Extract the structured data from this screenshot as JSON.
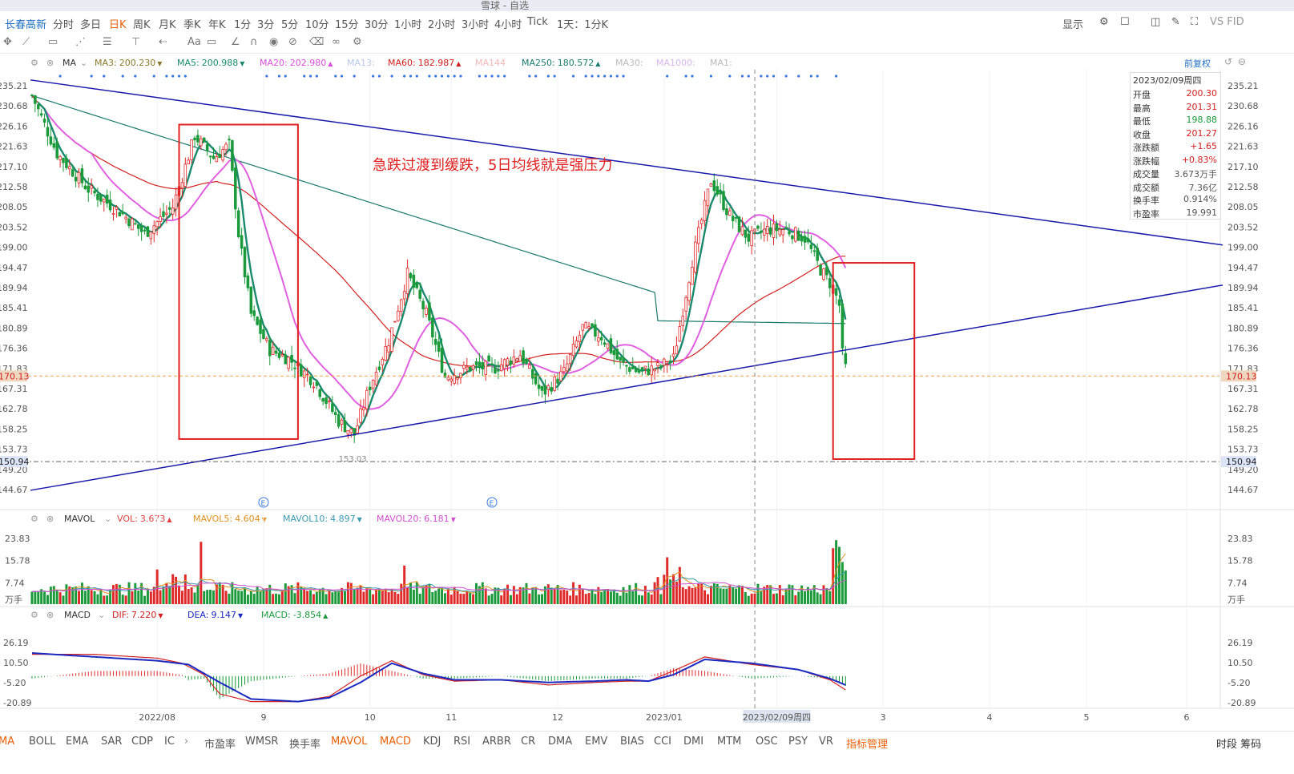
{
  "window": {
    "title": "雪球 - 自选"
  },
  "stock_name": "长春高新",
  "periods": [
    "分时",
    "多日",
    "日K",
    "周K",
    "月K",
    "季K",
    "年K",
    "1分",
    "3分",
    "5分",
    "10分",
    "15分",
    "30分",
    "1小时",
    "2小时",
    "3小时",
    "4小时",
    "Tick",
    "1天：1分K"
  ],
  "active_period": "日K",
  "right_controls": {
    "display": "显示",
    "vs": "VS FID"
  },
  "restore_label": "前复权",
  "main_legend": {
    "name": "MA",
    "items": [
      {
        "label": "MA3:",
        "value": "200.230",
        "arrow": "▼",
        "color": "#8a7a2c"
      },
      {
        "label": "MA5:",
        "value": "200.988",
        "arrow": "▼",
        "color": "#1a8a6e"
      },
      {
        "label": "MA20:",
        "value": "202.980",
        "arrow": "▲",
        "color": "#d84fd8"
      },
      {
        "label": "MA13:",
        "value": "",
        "arrow": "",
        "color": "#b8c8ee"
      },
      {
        "label": "MA60:",
        "value": "182.987",
        "arrow": "▲",
        "color": "#d22020"
      },
      {
        "label": "MA144",
        "value": "",
        "arrow": "",
        "color": "#f5b8b8"
      },
      {
        "label": "MA250:",
        "value": "180.572",
        "arrow": "▲",
        "color": "#1a7a6e"
      },
      {
        "label": "MA30:",
        "value": "",
        "arrow": "",
        "color": "#bbbbbb"
      },
      {
        "label": "MA1000:",
        "value": "",
        "arrow": "",
        "color": "#d8b8ee"
      },
      {
        "label": "MA1:",
        "value": "",
        "arrow": "",
        "color": "#bbbbbb"
      }
    ]
  },
  "vol_legend": {
    "name": "MAVOL",
    "items": [
      {
        "label": "VOL:",
        "value": "3.673",
        "arrow": "▲",
        "color": "#e04040"
      },
      {
        "label": "MAVOL5:",
        "value": "4.604",
        "arrow": "▼",
        "color": "#e09020"
      },
      {
        "label": "MAVOL10:",
        "value": "4.897",
        "arrow": "▼",
        "color": "#3a9ab0"
      },
      {
        "label": "MAVOL20:",
        "value": "6.181",
        "arrow": "▼",
        "color": "#d050d0"
      }
    ]
  },
  "macd_legend": {
    "name": "MACD",
    "items": [
      {
        "label": "DIF:",
        "value": "7.220",
        "arrow": "▼",
        "color": "#d22020"
      },
      {
        "label": "DEA:",
        "value": "9.147",
        "arrow": "▼",
        "color": "#1a2ac0"
      },
      {
        "label": "MACD:",
        "value": "-3.854",
        "arrow": "▲",
        "color": "#1a9a3a"
      }
    ]
  },
  "annotation_text": "急跌过渡到缓跌，5日均线就是强压力",
  "info_box": {
    "date": "2023/02/09周四",
    "rows": [
      {
        "k": "开盘",
        "v": "200.30",
        "c": "#d22020"
      },
      {
        "k": "最高",
        "v": "201.31",
        "c": "#d22020"
      },
      {
        "k": "最低",
        "v": "198.88",
        "c": "#1a9a3a"
      },
      {
        "k": "收盘",
        "v": "201.27",
        "c": "#d22020"
      },
      {
        "k": "涨跌额",
        "v": "+1.65",
        "c": "#d22020"
      },
      {
        "k": "涨跌幅",
        "v": "+0.83%",
        "c": "#d22020"
      },
      {
        "k": "成交量",
        "v": "3.673万手",
        "c": "#555555"
      },
      {
        "k": "成交额",
        "v": "7.36亿",
        "c": "#555555"
      },
      {
        "k": "换手率",
        "v": "0.914%",
        "c": "#555555"
      },
      {
        "k": "市盈率",
        "v": "19.991",
        "c": "#555555"
      }
    ]
  },
  "indicator_tabs": [
    "MA",
    "BOLL",
    "EMA",
    "SAR",
    "CDP",
    "IC",
    "市盈率",
    "WMSR",
    "换手率",
    "MAVOL",
    "MACD",
    "KDJ",
    "RSI",
    "ARBR",
    "CR",
    "DMA",
    "EMV",
    "BIAS",
    "CCI",
    "DMI",
    "MTM",
    "OSC",
    "PSY",
    "VR",
    "指标管理"
  ],
  "active_tabs": [
    "MA",
    "MAVOL",
    "MACD"
  ],
  "bottom_right_label": "时段  筹码",
  "chart_data": {
    "type": "candlestick",
    "price_axis_ticks": [
      "235.21",
      "230.68",
      "226.16",
      "221.63",
      "217.10",
      "212.58",
      "208.05",
      "203.52",
      "199.00",
      "194.47",
      "189.94",
      "185.41",
      "180.89",
      "176.36",
      "171.83",
      "167.31",
      "162.78",
      "158.25",
      "153.73",
      "149.20",
      "144.67"
    ],
    "price_ylim": [
      144.67,
      235.21
    ],
    "current_price": "170.13",
    "support_level": "150.94",
    "low_marker": "153.03",
    "x_ticks": [
      "2022/08",
      "9",
      "10",
      "11",
      "12",
      "2023/01",
      "2023/02/09周四",
      "3",
      "4",
      "5",
      "6"
    ],
    "crosshair_date": "2023/02/09周四",
    "price_path": [
      [
        0,
        233
      ],
      [
        8,
        220
      ],
      [
        18,
        212
      ],
      [
        28,
        207
      ],
      [
        36,
        202
      ],
      [
        45,
        208
      ],
      [
        52,
        224
      ],
      [
        58,
        219
      ],
      [
        63,
        222
      ],
      [
        66,
        202
      ],
      [
        70,
        184
      ],
      [
        76,
        176
      ],
      [
        82,
        174
      ],
      [
        90,
        169
      ],
      [
        98,
        160
      ],
      [
        103,
        157
      ],
      [
        108,
        168
      ],
      [
        114,
        178
      ],
      [
        120,
        193
      ],
      [
        126,
        184
      ],
      [
        132,
        170
      ],
      [
        140,
        172
      ],
      [
        148,
        172
      ],
      [
        156,
        175
      ],
      [
        163,
        166
      ],
      [
        170,
        171
      ],
      [
        176,
        181
      ],
      [
        182,
        179
      ],
      [
        188,
        173
      ],
      [
        194,
        171
      ],
      [
        200,
        172
      ],
      [
        205,
        174
      ],
      [
        211,
        196
      ],
      [
        217,
        214
      ],
      [
        223,
        206
      ],
      [
        229,
        201
      ],
      [
        235,
        203
      ],
      [
        241,
        203
      ],
      [
        247,
        201
      ],
      [
        252,
        194
      ],
      [
        256,
        190
      ],
      [
        258,
        186
      ],
      [
        259,
        175
      ],
      [
        260,
        172
      ]
    ],
    "trendlines": [
      {
        "name": "upper",
        "from": [
          0,
          236.5
        ],
        "to": [
          380,
          199.5
        ]
      },
      {
        "name": "lower",
        "from": [
          0,
          144.5
        ],
        "to": [
          380,
          190.5
        ]
      }
    ],
    "volume_axis_ticks": [
      "23.83",
      "15.78",
      "7.74",
      "万手"
    ],
    "volume_ylim": [
      0,
      23.83
    ],
    "macd_axis_ticks": [
      "26.19",
      "10.50",
      "-5.20",
      "-20.89"
    ],
    "macd_ylim": [
      -20.89,
      26.19
    ],
    "dif_path": [
      [
        0,
        17
      ],
      [
        20,
        17
      ],
      [
        40,
        14
      ],
      [
        48,
        10
      ],
      [
        55,
        1
      ],
      [
        60,
        -14
      ],
      [
        70,
        -20
      ],
      [
        85,
        -20
      ],
      [
        95,
        -16
      ],
      [
        105,
        0
      ],
      [
        115,
        12
      ],
      [
        125,
        1
      ],
      [
        135,
        -4
      ],
      [
        150,
        -3
      ],
      [
        165,
        -7
      ],
      [
        180,
        -5
      ],
      [
        190,
        -4
      ],
      [
        197,
        -4
      ],
      [
        205,
        4
      ],
      [
        215,
        15
      ],
      [
        230,
        9
      ],
      [
        245,
        5
      ],
      [
        255,
        -3
      ],
      [
        262,
        -14
      ]
    ],
    "dea_path": [
      [
        0,
        18
      ],
      [
        20,
        15
      ],
      [
        40,
        12
      ],
      [
        50,
        9
      ],
      [
        60,
        -5
      ],
      [
        70,
        -18
      ],
      [
        85,
        -20
      ],
      [
        95,
        -17
      ],
      [
        105,
        -5
      ],
      [
        115,
        10
      ],
      [
        125,
        2
      ],
      [
        135,
        -3
      ],
      [
        150,
        -3
      ],
      [
        165,
        -5
      ],
      [
        180,
        -4
      ],
      [
        190,
        -3
      ],
      [
        197,
        -4
      ],
      [
        205,
        1
      ],
      [
        215,
        13
      ],
      [
        230,
        10
      ],
      [
        245,
        5
      ],
      [
        255,
        -2
      ],
      [
        262,
        -9
      ]
    ]
  }
}
